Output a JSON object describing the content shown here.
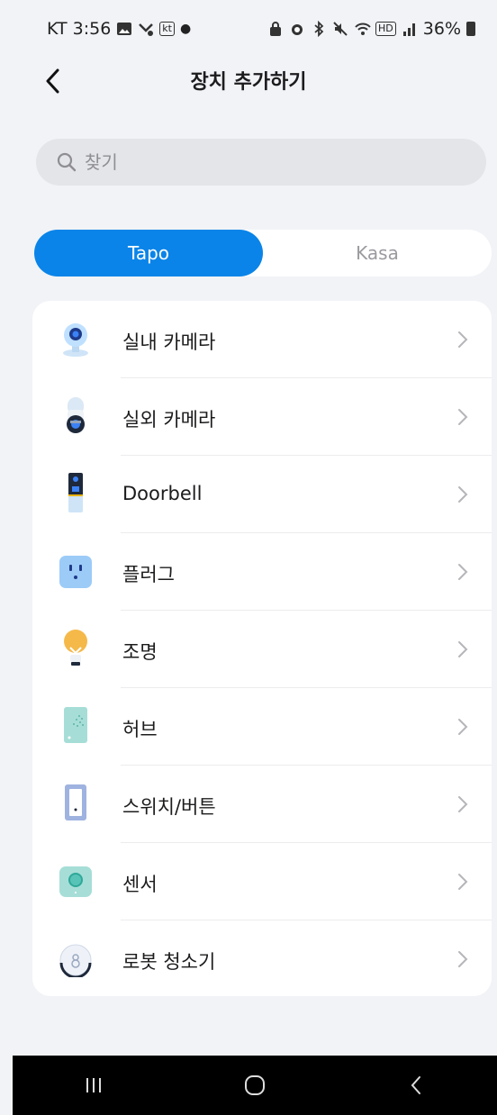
{
  "status_bar": {
    "carrier_time": "KT 3:56",
    "kt_badge": "kt",
    "hd_badge": "HD",
    "battery": "36%"
  },
  "header": {
    "title": "장치 추가하기"
  },
  "search": {
    "placeholder": "찾기"
  },
  "brand_tabs": [
    {
      "label": "Tapo",
      "selected": true
    },
    {
      "label": "Kasa",
      "selected": false
    }
  ],
  "devices": [
    {
      "label": "실내 카메라",
      "icon": "indoor-camera-icon"
    },
    {
      "label": "실외 카메라",
      "icon": "outdoor-camera-icon"
    },
    {
      "label": "Doorbell",
      "icon": "doorbell-icon"
    },
    {
      "label": "플러그",
      "icon": "plug-icon"
    },
    {
      "label": "조명",
      "icon": "bulb-icon"
    },
    {
      "label": "허브",
      "icon": "hub-icon"
    },
    {
      "label": "스위치/버튼",
      "icon": "switch-icon"
    },
    {
      "label": "센서",
      "icon": "sensor-icon"
    },
    {
      "label": "로봇 청소기",
      "icon": "robot-vacuum-icon"
    }
  ],
  "colors": {
    "accent": "#0a84e8",
    "background": "#f2f3f7"
  }
}
